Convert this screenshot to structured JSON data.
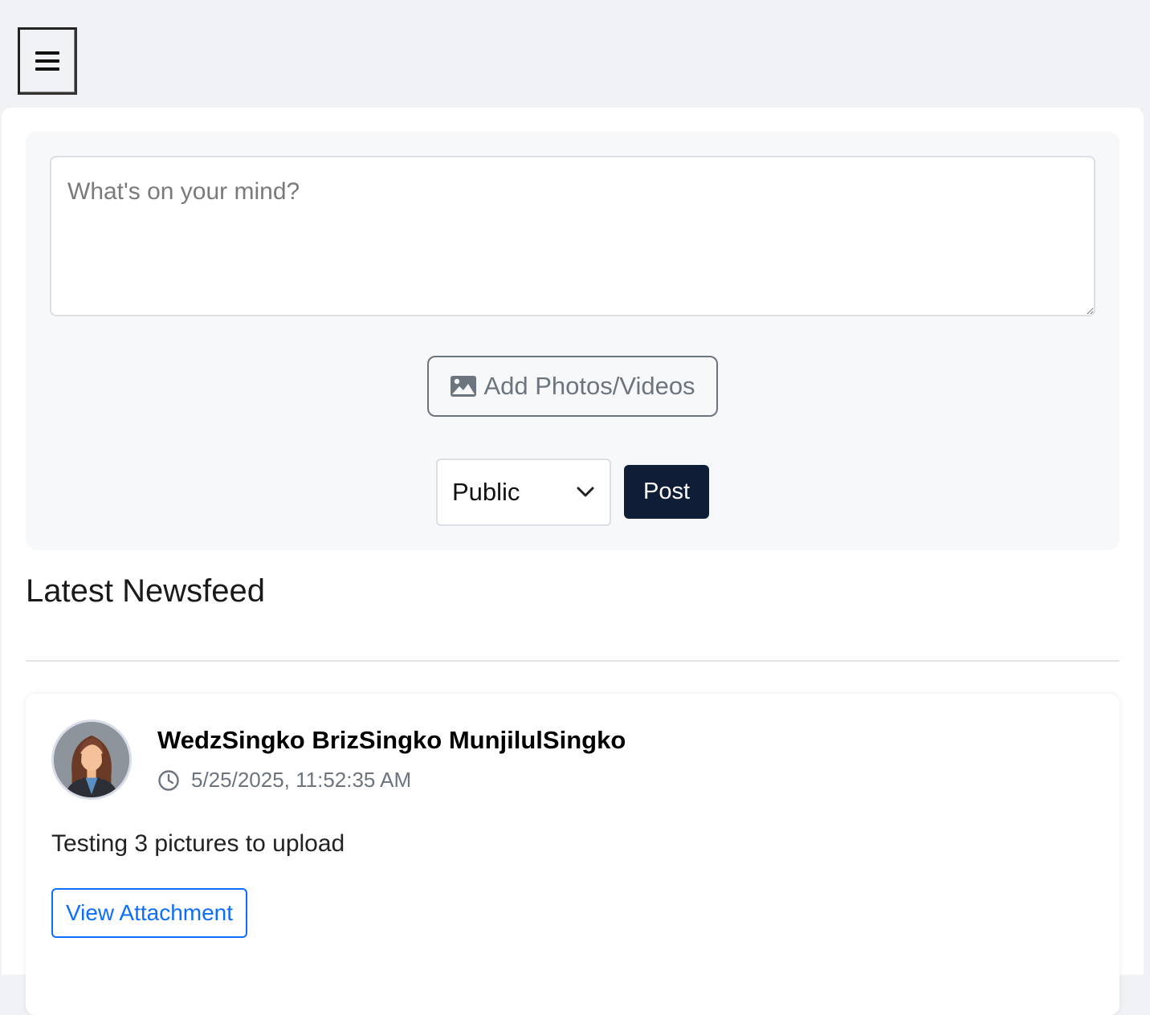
{
  "menu": {
    "icon": "hamburger-icon"
  },
  "composer": {
    "placeholder": "What's on your mind?",
    "add_media_label": "Add Photos/Videos",
    "add_media_icon": "image-icon",
    "privacy": {
      "selected": "Public",
      "options": [
        "Public"
      ]
    },
    "post_label": "Post"
  },
  "feed": {
    "title": "Latest Newsfeed",
    "posts": [
      {
        "author": "WedzSingko BrizSingko MunjilulSingko",
        "timestamp": "5/25/2025, 11:52:35 AM",
        "timestamp_icon": "clock-icon",
        "body": "Testing 3 pictures to upload",
        "attachment_label": "View Attachment"
      }
    ]
  },
  "colors": {
    "background": "#f0f2f5",
    "panel": "#ffffff",
    "composer_bg": "#f7f8fa",
    "post_button": "#0f1e36",
    "link_blue": "#0d6efd",
    "muted": "#6c757d"
  }
}
